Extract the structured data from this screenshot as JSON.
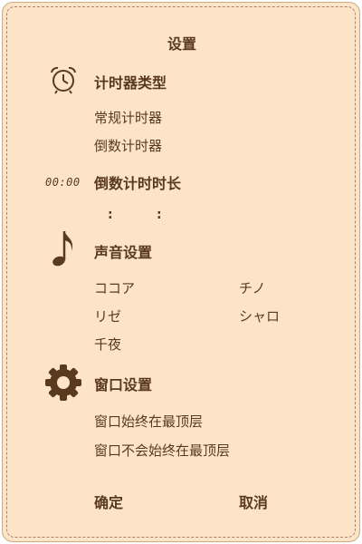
{
  "window": {
    "title": "设置"
  },
  "sections": {
    "timer_type": {
      "icon": "alarm-clock-icon",
      "heading": "计时器类型",
      "options": [
        "常规计时器",
        "倒数计时器"
      ]
    },
    "countdown": {
      "icon_text": "00:00",
      "heading": "倒数计时时长",
      "colon1": ":",
      "colon2": ":"
    },
    "sound": {
      "icon": "music-note-icon",
      "heading": "声音设置",
      "options": [
        "ココア",
        "チノ",
        "リゼ",
        "シャロ",
        "千夜"
      ]
    },
    "window_settings": {
      "icon": "gear-icon",
      "heading": "窗口设置",
      "options": [
        "窗口始终在最顶层",
        "窗口不会始终在最顶层"
      ]
    }
  },
  "buttons": {
    "confirm": "确定",
    "cancel": "取消"
  },
  "colors": {
    "background": "#fde3c8",
    "text": "#5a3a1e",
    "border": "#a88566"
  }
}
